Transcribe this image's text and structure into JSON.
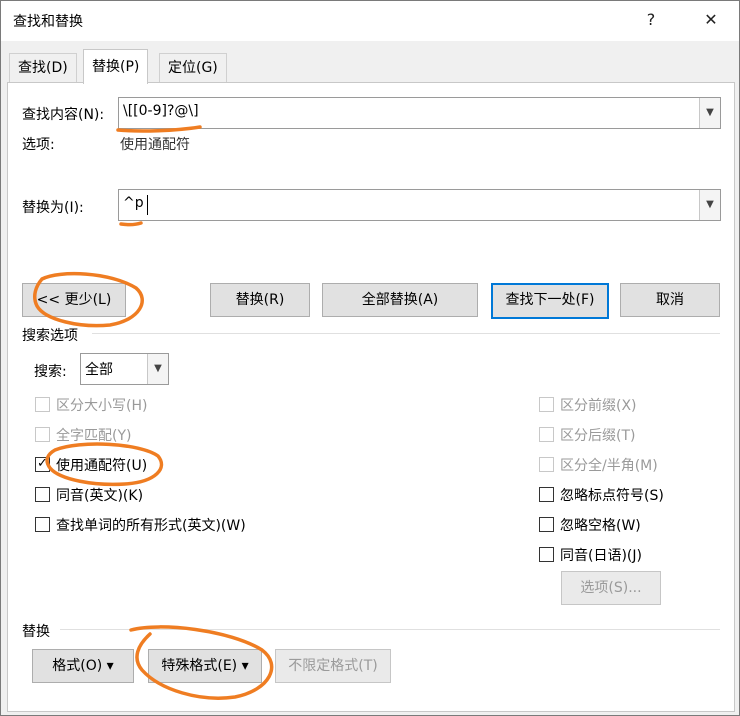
{
  "window": {
    "title": "查找和替换",
    "help_glyph": "?",
    "close_glyph": "✕"
  },
  "tabs": [
    {
      "label": "查找(D)",
      "active": false
    },
    {
      "label": "替换(P)",
      "active": true
    },
    {
      "label": "定位(G)",
      "active": false
    }
  ],
  "find": {
    "label": "查找内容(N):",
    "value": "\\[[0-9]?@\\]",
    "options_label": "选项:",
    "options_value": "使用通配符"
  },
  "replace": {
    "label": "替换为(I):",
    "value": "^p"
  },
  "buttons": {
    "less": "<< 更少(L)",
    "replace": "替换(R)",
    "replace_all": "全部替换(A)",
    "find_next": "查找下一处(F)",
    "cancel": "取消"
  },
  "search_options": {
    "section_label": "搜索选项",
    "search_label": "搜索:",
    "search_value": "全部",
    "left_checks": [
      {
        "label": "区分大小写(H)",
        "checked": false,
        "enabled": false
      },
      {
        "label": "全字匹配(Y)",
        "checked": false,
        "enabled": false
      },
      {
        "label": "使用通配符(U)",
        "checked": true,
        "enabled": true
      },
      {
        "label": "同音(英文)(K)",
        "checked": false,
        "enabled": true
      },
      {
        "label": "查找单词的所有形式(英文)(W)",
        "checked": false,
        "enabled": true
      }
    ],
    "right_checks": [
      {
        "label": "区分前缀(X)",
        "checked": false,
        "enabled": false
      },
      {
        "label": "区分后缀(T)",
        "checked": false,
        "enabled": false
      },
      {
        "label": "区分全/半角(M)",
        "checked": false,
        "enabled": false
      },
      {
        "label": "忽略标点符号(S)",
        "checked": false,
        "enabled": true
      },
      {
        "label": "忽略空格(W)",
        "checked": false,
        "enabled": true
      },
      {
        "label": "同音(日语)(J)",
        "checked": false,
        "enabled": true
      }
    ],
    "options_button": "选项(S)..."
  },
  "replace_section": {
    "section_label": "替换",
    "format_button": "格式(O) ▾",
    "special_button": "特殊格式(E) ▾",
    "no_format_button": "不限定格式(T)"
  },
  "colors": {
    "annotation": "#ef7d22",
    "focus": "#0078d7"
  }
}
